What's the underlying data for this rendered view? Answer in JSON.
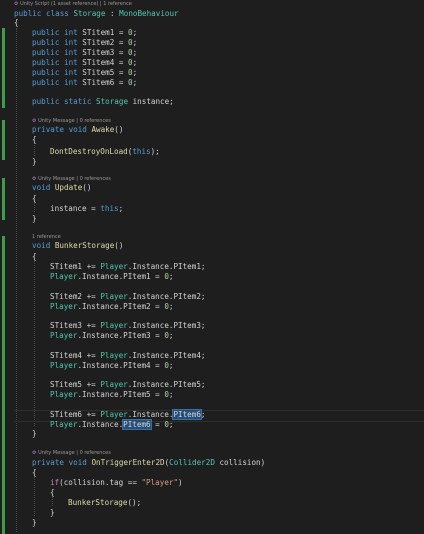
{
  "codelens": {
    "class_ref": "Unity Script (1 asset reference) | 1 reference",
    "awake_ref": "Unity Message | 0 references",
    "update_ref": "Unity Message | 0 references",
    "bunker_ref": "1 reference",
    "trigger_ref": "Unity Message | 0 references",
    "lens_icon": "⚙"
  },
  "code": {
    "class_kw": "public class ",
    "class_name": "Storage",
    "colon": " : ",
    "base_class": "MonoBehaviour",
    "open_brace": "{",
    "close_brace": "}",
    "field_kw": "public int ",
    "fields": [
      {
        "name": "STitem1",
        "rest": " = ",
        "value": "0",
        "end": ";"
      },
      {
        "name": "STitem2",
        "rest": " = ",
        "value": "0",
        "end": ";"
      },
      {
        "name": "STitem3",
        "rest": " = ",
        "value": "0",
        "end": ";"
      },
      {
        "name": "STitem4",
        "rest": " = ",
        "value": "0",
        "end": ";"
      },
      {
        "name": "STitem5",
        "rest": " = ",
        "value": "0",
        "end": ";"
      },
      {
        "name": "STitem6",
        "rest": " = ",
        "value": "0",
        "end": ";"
      }
    ],
    "instance_decl_kw": "public static ",
    "instance_type": "Storage",
    "instance_name": " instance;",
    "private_void": "private void ",
    "awake": "Awake",
    "parens": "()",
    "dont_destroy": "DontDestroyOnLoad",
    "open_paren": "(",
    "this_kw": "this",
    "close_stmt": ");",
    "update": "Update",
    "instance_assign": "instance = ",
    "semicolon": ";",
    "void_kw": "void ",
    "bunker": "BunkerStorage",
    "player": "Player",
    "dot_instance": ".Instance.",
    "plus_eq": " += ",
    "eq_zero_rhs": " = ",
    "zero": "0",
    "pitems": [
      "PItem1",
      "PItem2",
      "PItem3",
      "PItem4",
      "PItem5",
      "PItem6"
    ],
    "on_trigger": "OnTriggerEnter2D",
    "collider_type": "Collider2D",
    "collision_param": " collision",
    "close_paren": ")",
    "if_kw": "if",
    "collision": "collision",
    "tag_eq": ".tag == ",
    "player_str": "\"Player\"",
    "bunker_call": "BunkerStorage",
    "call_end": "();"
  }
}
